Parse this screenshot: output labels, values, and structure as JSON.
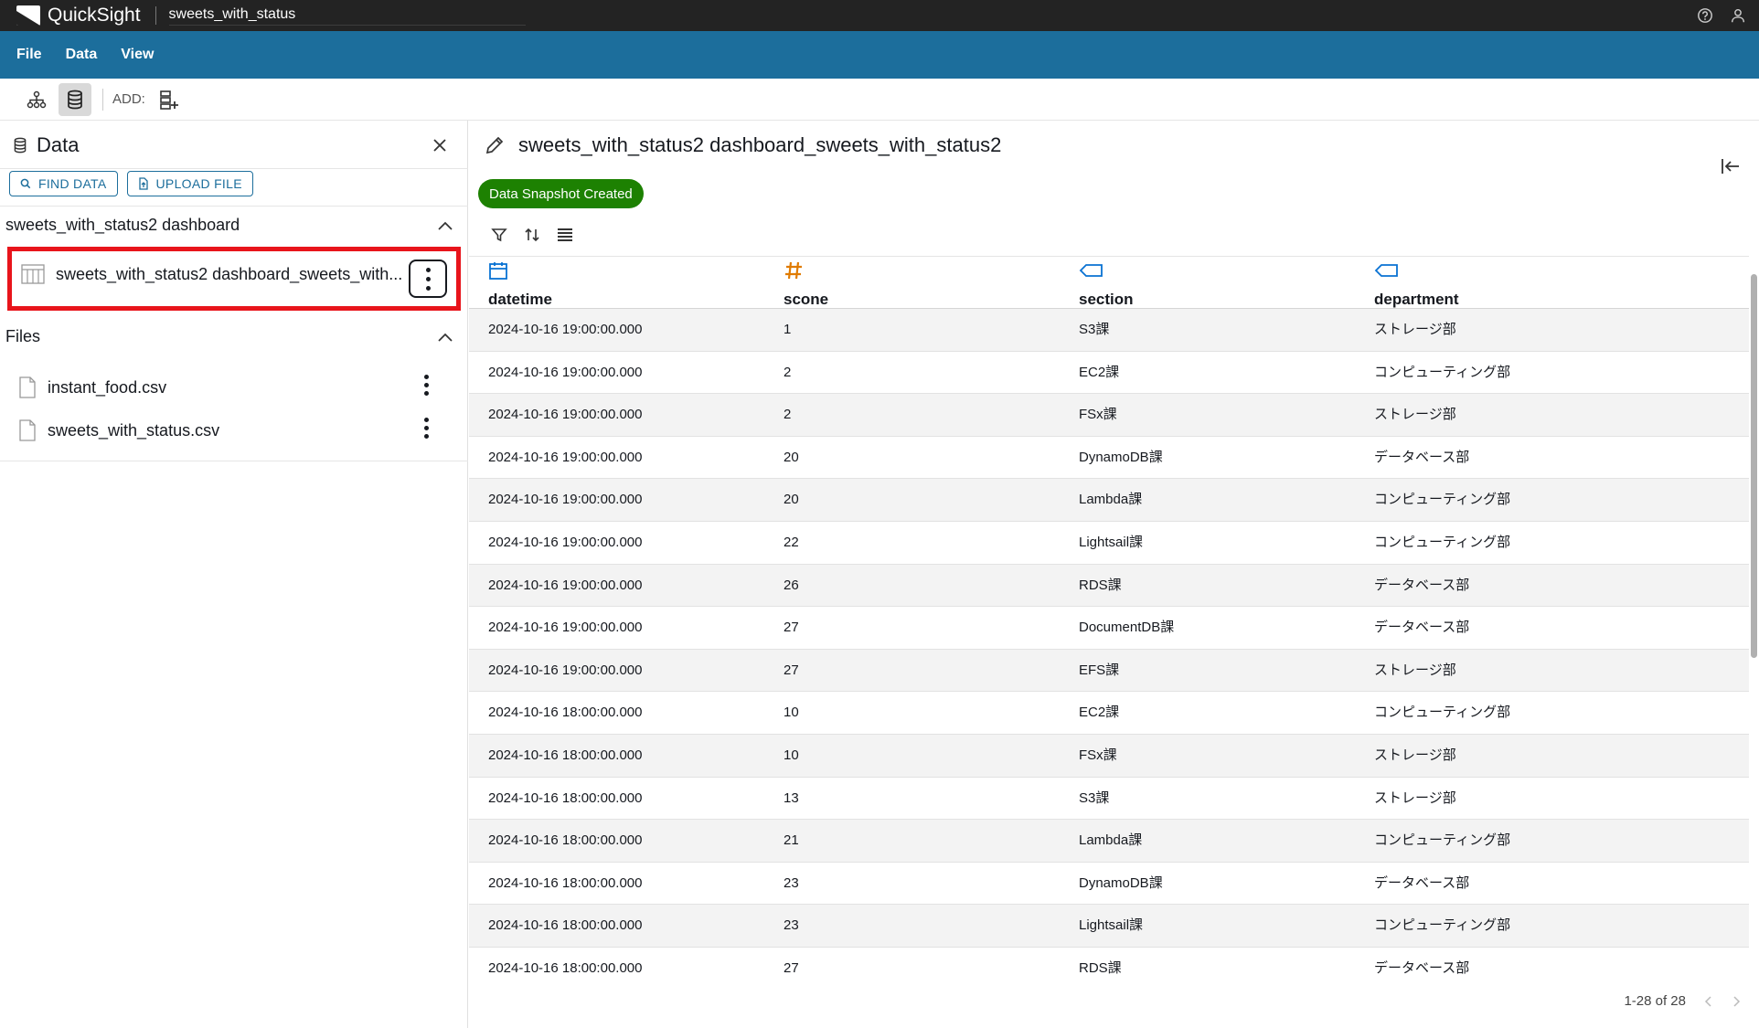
{
  "app": {
    "brand": "QuickSight",
    "analysis_name": "sweets_with_status"
  },
  "menu": [
    "File",
    "Data",
    "View"
  ],
  "toolbar": {
    "add_label": "ADD:"
  },
  "data_panel": {
    "title": "Data",
    "find_data": "FIND DATA",
    "upload_file": "UPLOAD FILE",
    "dataset_group": "sweets_with_status2 dashboard",
    "dataset_item": "sweets_with_status2 dashboard_sweets_with...",
    "files_group": "Files",
    "files": [
      "instant_food.csv",
      "sweets_with_status.csv"
    ]
  },
  "main": {
    "title": "sweets_with_status2 dashboard_sweets_with_status2",
    "badge": "Data Snapshot Created",
    "columns": [
      {
        "name": "datetime",
        "type": "date",
        "icon": "calendar-icon"
      },
      {
        "name": "scone",
        "type": "number",
        "icon": "hash-icon"
      },
      {
        "name": "section",
        "type": "string",
        "icon": "tag-icon"
      },
      {
        "name": "department",
        "type": "string",
        "icon": "tag-icon"
      }
    ],
    "rows": [
      [
        "2024-10-16 19:00:00.000",
        "1",
        "S3課",
        "ストレージ部"
      ],
      [
        "2024-10-16 19:00:00.000",
        "2",
        "EC2課",
        "コンピューティング部"
      ],
      [
        "2024-10-16 19:00:00.000",
        "2",
        "FSx課",
        "ストレージ部"
      ],
      [
        "2024-10-16 19:00:00.000",
        "20",
        "DynamoDB課",
        "データベース部"
      ],
      [
        "2024-10-16 19:00:00.000",
        "20",
        "Lambda課",
        "コンピューティング部"
      ],
      [
        "2024-10-16 19:00:00.000",
        "22",
        "Lightsail課",
        "コンピューティング部"
      ],
      [
        "2024-10-16 19:00:00.000",
        "26",
        "RDS課",
        "データベース部"
      ],
      [
        "2024-10-16 19:00:00.000",
        "27",
        "DocumentDB課",
        "データベース部"
      ],
      [
        "2024-10-16 19:00:00.000",
        "27",
        "EFS課",
        "ストレージ部"
      ],
      [
        "2024-10-16 18:00:00.000",
        "10",
        "EC2課",
        "コンピューティング部"
      ],
      [
        "2024-10-16 18:00:00.000",
        "10",
        "FSx課",
        "ストレージ部"
      ],
      [
        "2024-10-16 18:00:00.000",
        "13",
        "S3課",
        "ストレージ部"
      ],
      [
        "2024-10-16 18:00:00.000",
        "21",
        "Lambda課",
        "コンピューティング部"
      ],
      [
        "2024-10-16 18:00:00.000",
        "23",
        "DynamoDB課",
        "データベース部"
      ],
      [
        "2024-10-16 18:00:00.000",
        "23",
        "Lightsail課",
        "コンピューティング部"
      ],
      [
        "2024-10-16 18:00:00.000",
        "27",
        "RDS課",
        "データベース部"
      ]
    ],
    "pagination": "1-28 of 28"
  },
  "colors": {
    "menu_bar": "#1c6e9c",
    "top_bar": "#232323",
    "badge": "#1d8102",
    "highlight": "#e8141b",
    "accent": "#0972d3"
  }
}
